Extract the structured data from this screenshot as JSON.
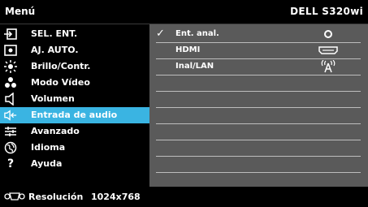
{
  "titlebar": {
    "menu_label": "Menú",
    "model": "DELL S320wi"
  },
  "sidebar": {
    "items": [
      {
        "label": "SEL. ENT.",
        "icon": "input-source-icon",
        "active": false
      },
      {
        "label": "AJ. AUTO.",
        "icon": "auto-adjust-icon",
        "active": false
      },
      {
        "label": "Brillo/Contr.",
        "icon": "brightness-icon",
        "active": false
      },
      {
        "label": "Modo Vídeo",
        "icon": "video-mode-icon",
        "active": false
      },
      {
        "label": "Volumen",
        "icon": "speaker-icon",
        "active": false
      },
      {
        "label": "Entrada de audio",
        "icon": "audio-input-icon",
        "active": true
      },
      {
        "label": "Avanzado",
        "icon": "advanced-settings-icon",
        "active": false
      },
      {
        "label": "Idioma",
        "icon": "globe-icon",
        "active": false
      },
      {
        "label": "Ayuda",
        "icon": "question-icon",
        "active": false
      }
    ]
  },
  "panel": {
    "options": [
      {
        "label": "Ent. anal.",
        "selected": true,
        "icon": "analog-input-icon"
      },
      {
        "label": "HDMI",
        "selected": false,
        "icon": "hdmi-port-icon"
      },
      {
        "label": "Inal/LAN",
        "selected": false,
        "icon": "wireless-antenna-icon"
      }
    ],
    "check_glyph": "✓"
  },
  "footer": {
    "label": "Resolución",
    "value": "1024x768",
    "icon": "vga-connector-icon"
  },
  "colors": {
    "background": "#000000",
    "panel": "#5a5a5a",
    "highlight": "#3ab4e2",
    "text": "#ffffff",
    "divider": "#bdbdbd"
  }
}
